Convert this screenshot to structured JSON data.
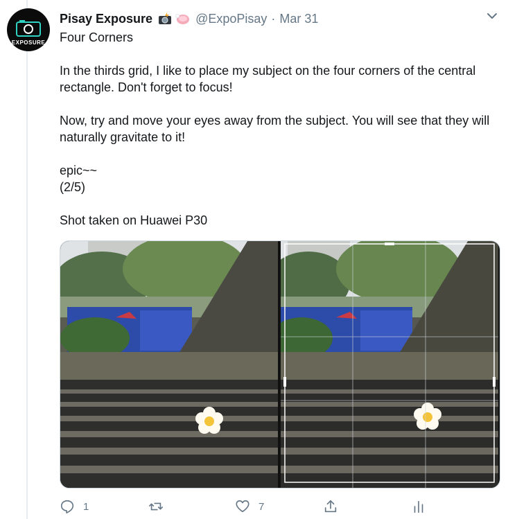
{
  "tweet": {
    "display_name": "Pisay Exposure",
    "handle": "@ExpoPisay",
    "separator": "·",
    "date": "Mar 31",
    "avatar_text": "EXPOSURE",
    "lines": [
      "Four Corners",
      "",
      "In the thirds grid, I like to place my subject on the four corners of the central rectangle. Don't forget to focus!",
      "",
      "Now, try and move your eyes away from the subject. You will see that they will naturally gravitate to it!",
      "",
      "epic~~",
      "(2/5)",
      "",
      "Shot taken on Huawei P30"
    ]
  },
  "actions": {
    "reply_count": "1",
    "retweet_count": "",
    "like_count": "7"
  },
  "icons": {
    "name_emoji": [
      "camera-with-flash-icon",
      "soap-icon"
    ],
    "menu": "chevron-down-icon",
    "reply": "reply-icon",
    "retweet": "retweet-icon",
    "like": "heart-icon",
    "share": "share-icon",
    "analytics": "analytics-icon"
  },
  "colors": {
    "text": "#14171a",
    "muted": "#657786",
    "thread_line": "#e6ecf0"
  }
}
